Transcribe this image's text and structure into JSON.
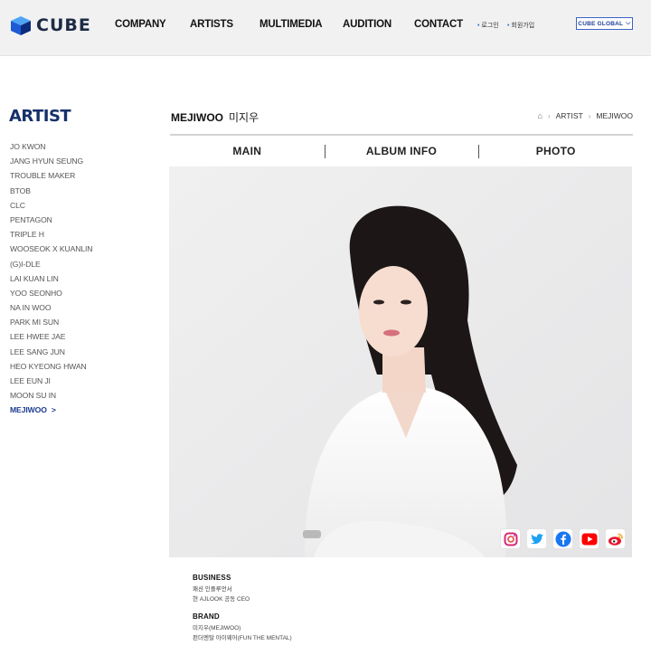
{
  "header": {
    "logo_text": "CUBE",
    "nav": [
      "COMPANY",
      "ARTISTS",
      "MULTIMEDIA",
      "AUDITION",
      "CONTACT"
    ],
    "util_links": [
      "로그인",
      "회원가입"
    ],
    "global_label": "CUBE GLOBAL"
  },
  "sidebar": {
    "title": "ARTIST",
    "items": [
      "JO KWON",
      "JANG HYUN SEUNG",
      "TROUBLE MAKER",
      "BTOB",
      "CLC",
      "PENTAGON",
      "TRIPLE H",
      "WOOSEOK X KUANLIN",
      "(G)I-DLE",
      "LAI KUAN LIN",
      "YOO SEONHO",
      "NA IN WOO",
      "PARK MI SUN",
      "LEE HWEE JAE",
      "LEE SANG JUN",
      "HEO KYEONG HWAN",
      "LEE EUN JI",
      "MOON SU IN",
      "MEJIWOO"
    ],
    "active_index": 18,
    "active_arrow": ">"
  },
  "artist": {
    "name_en": "MEJIWOO",
    "name_ko": "미지우"
  },
  "breadcrumb": [
    "ARTIST",
    "MEJIWOO"
  ],
  "tabs": [
    "MAIN",
    "ALBUM INFO",
    "PHOTO"
  ],
  "sns": [
    {
      "name": "instagram-icon"
    },
    {
      "name": "twitter-icon"
    },
    {
      "name": "facebook-icon"
    },
    {
      "name": "youtube-icon"
    },
    {
      "name": "weibo-icon"
    }
  ],
  "info": {
    "business_title": "BUSINESS",
    "business_lines": [
      "패션 인플루언서",
      "현 AJLOOK 공동 CEO"
    ],
    "brand_title": "BRAND",
    "brand_lines": [
      "미지우(MEJIWOO)",
      "펀더멘탈 아이웨어(FUN THE MENTAL)"
    ]
  },
  "colors": {
    "brand_navy": "#16306b",
    "active_blue": "#1c3a8f",
    "header_bg": "#f1f1f2"
  }
}
